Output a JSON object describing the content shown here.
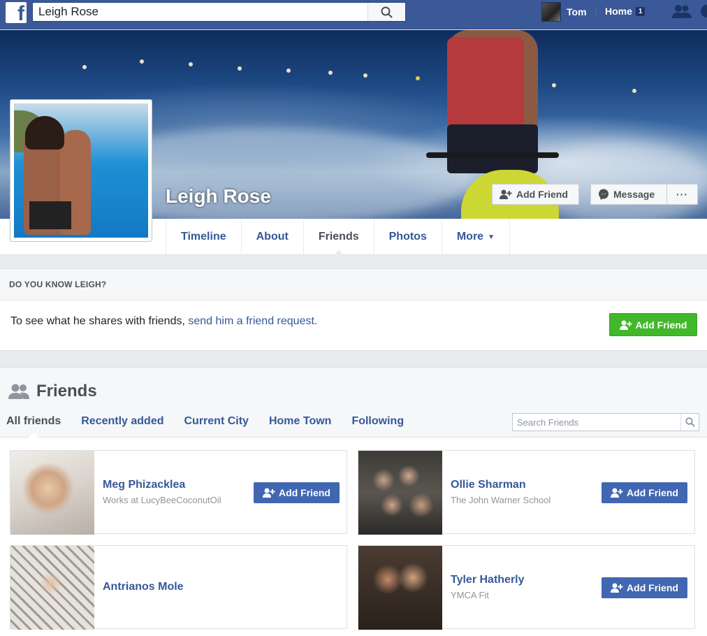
{
  "topbar": {
    "logo_letter": "f",
    "search_value": "Leigh Rose",
    "user_name": "Tom",
    "home_label": "Home",
    "home_count": "1"
  },
  "profile": {
    "name": "Leigh Rose",
    "add_friend_label": "Add Friend",
    "message_label": "Message",
    "more_dots": "···"
  },
  "nav": {
    "tabs": [
      {
        "label": "Timeline"
      },
      {
        "label": "About"
      },
      {
        "label": "Friends"
      },
      {
        "label": "Photos"
      },
      {
        "label": "More"
      }
    ],
    "active_tab": "Friends"
  },
  "know": {
    "heading": "DO YOU KNOW LEIGH?",
    "text": "To see what he shares with friends, ",
    "link": "send him a friend request.",
    "button": "Add Friend"
  },
  "friends": {
    "title": "Friends",
    "tabs": [
      {
        "label": "All friends"
      },
      {
        "label": "Recently added"
      },
      {
        "label": "Current City"
      },
      {
        "label": "Home Town"
      },
      {
        "label": "Following"
      }
    ],
    "search_placeholder": "Search Friends",
    "cards": [
      {
        "name": "Meg Phizacklea",
        "subtitle": "Works at LucyBeeCoconutOil",
        "button": "Add Friend"
      },
      {
        "name": "Ollie Sharman",
        "subtitle": "The John Warner School",
        "button": "Add Friend"
      },
      {
        "name": "Antrianos Mole",
        "subtitle": "",
        "button": ""
      },
      {
        "name": "Tyler Hatherly",
        "subtitle": "YMCA Fit",
        "button": "Add Friend"
      }
    ]
  },
  "colors": {
    "brand_blue": "#3b5998",
    "link_blue": "#365899",
    "button_blue": "#4267b2",
    "button_green": "#42b72a"
  }
}
